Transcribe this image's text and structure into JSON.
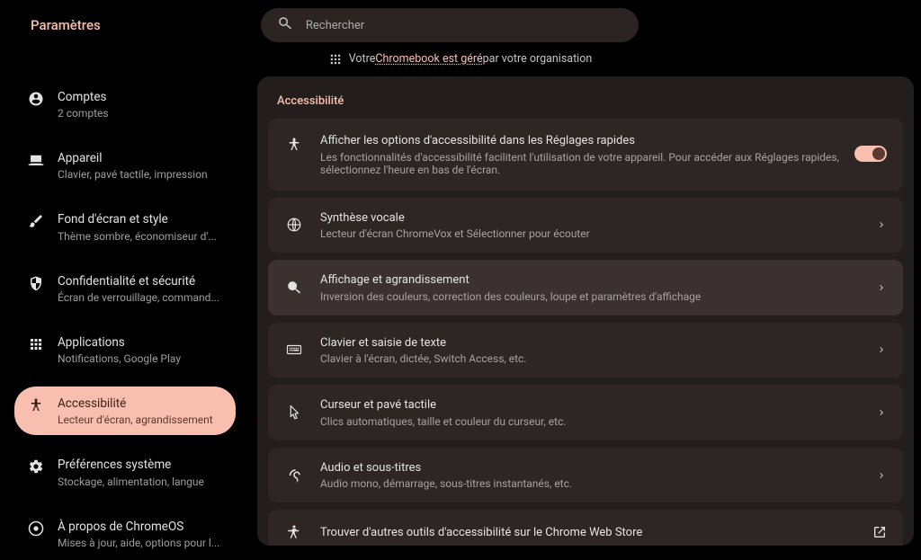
{
  "header": {
    "title": "Paramètres",
    "search_placeholder": "Rechercher"
  },
  "banner": {
    "prefix": "Votre ",
    "link": "Chromebook est géré",
    "suffix": " par votre organisation"
  },
  "sidebar": {
    "items": [
      {
        "label": "Comptes",
        "sublabel": "2 comptes"
      },
      {
        "label": "Appareil",
        "sublabel": "Clavier, pavé tactile, impression"
      },
      {
        "label": "Fond d'écran et style",
        "sublabel": "Thème sombre, économiseur d'..."
      },
      {
        "label": "Confidentialité et sécurité",
        "sublabel": "Écran de verrouillage, command..."
      },
      {
        "label": "Applications",
        "sublabel": "Notifications, Google Play"
      },
      {
        "label": "Accessibilité",
        "sublabel": "Lecteur d'écran, agrandissement"
      },
      {
        "label": "Préférences système",
        "sublabel": "Stockage, alimentation, langue"
      },
      {
        "label": "À propos de ChromeOS",
        "sublabel": "Mises à jour, aide, options pour l..."
      }
    ]
  },
  "content": {
    "section_title": "Accessibilité",
    "rows": [
      {
        "label": "Afficher les options d'accessibilité dans les Réglages rapides",
        "sublabel": "Les fonctionnalités d'accessibilité facilitent l'utilisation de votre appareil. Pour accéder aux Réglages rapides, sélectionnez l'heure en bas de l'écran.",
        "trailing": "toggle_on"
      },
      {
        "label": "Synthèse vocale",
        "sublabel": "Lecteur d'écran ChromeVox et Sélectionner pour écouter",
        "trailing": "chevron"
      },
      {
        "label": "Affichage et agrandissement",
        "sublabel": "Inversion des couleurs, correction des couleurs, loupe et paramètres d'affichage",
        "trailing": "chevron",
        "highlighted": true
      },
      {
        "label": "Clavier et saisie de texte",
        "sublabel": "Clavier à l'écran, dictée, Switch Access, etc.",
        "trailing": "chevron"
      },
      {
        "label": "Curseur et pavé tactile",
        "sublabel": "Clics automatiques, taille et couleur du curseur, etc.",
        "trailing": "chevron"
      },
      {
        "label": "Audio et sous-titres",
        "sublabel": "Audio mono, démarrage, sous-titres instantanés, etc.",
        "trailing": "chevron"
      },
      {
        "label": "Trouver d'autres outils d'accessibilité sur le Chrome Web Store",
        "trailing": "openext"
      }
    ]
  }
}
